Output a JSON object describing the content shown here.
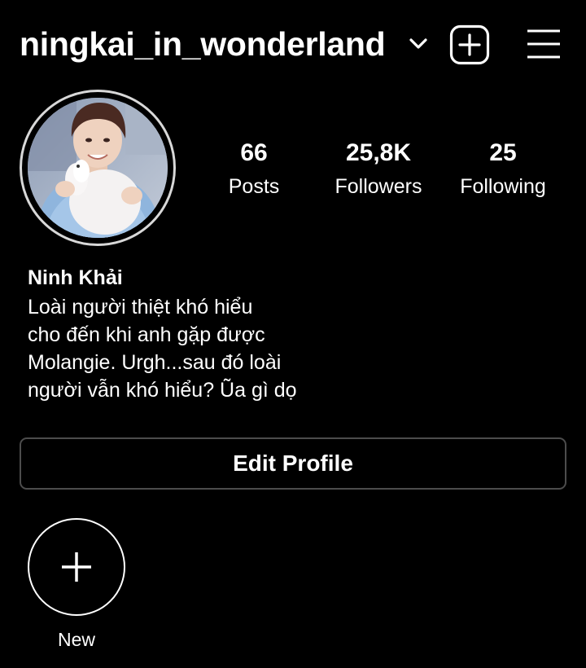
{
  "header": {
    "username": "ningkai_in_wonderland",
    "chevron_icon": "chevron-down-icon",
    "add_icon": "add-post-icon",
    "menu_icon": "hamburger-menu-icon"
  },
  "profile": {
    "avatar_icon": "profile-photo",
    "stats": {
      "posts": {
        "value": "66",
        "label": "Posts"
      },
      "followers": {
        "value": "25,8K",
        "label": "Followers"
      },
      "following": {
        "value": "25",
        "label": "Following"
      }
    },
    "display_name": "Ninh Khải",
    "bio_lines": [
      "Loài người thiệt khó hiểu",
      "cho đến khi anh gặp được",
      "Molangie. Urgh...sau đó loài",
      "người vẫn khó hiểu? Ũa gì dọ"
    ]
  },
  "actions": {
    "edit_profile_label": "Edit Profile"
  },
  "highlights": {
    "new_label": "New",
    "new_icon": "plus-icon"
  },
  "colors": {
    "background": "#000000",
    "text": "#ffffff",
    "button_border": "#4c4c4c"
  }
}
